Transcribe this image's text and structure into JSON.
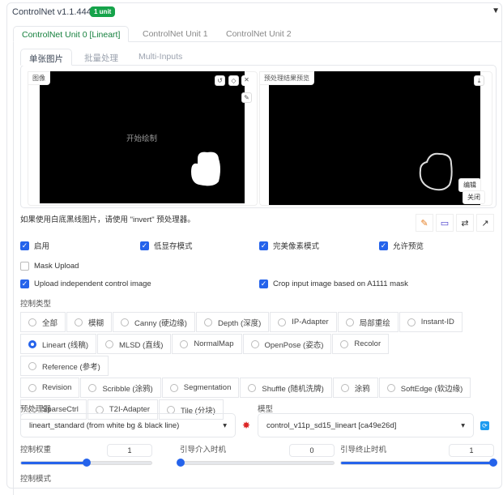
{
  "header": {
    "title": "ControlNet v1.1.444",
    "badge": "1 unit",
    "collapse_icon": "▼"
  },
  "unit_tabs": [
    "ControlNet Unit 0 [Lineart]",
    "ControlNet Unit 1",
    "ControlNet Unit 2"
  ],
  "sub_tabs": [
    "单张图片",
    "批量处理",
    "Multi-Inputs"
  ],
  "image_panel": {
    "label": "图像",
    "placeholder": "开始绘制"
  },
  "preview_panel": {
    "label": "预处理结果预览",
    "edit": "编辑",
    "close": "关闭"
  },
  "hint": "如果使用白底黑线图片，请使用 \"invert\" 预处理器。",
  "checkboxes": [
    {
      "label": "启用",
      "checked": true
    },
    {
      "label": "低显存模式",
      "checked": true
    },
    {
      "label": "完美像素模式",
      "checked": true
    },
    {
      "label": "允许预览",
      "checked": true
    },
    {
      "label": "Mask Upload",
      "checked": false
    },
    {
      "label": "Upload independent control image",
      "checked": true
    },
    {
      "label": "Crop input image based on A1111 mask",
      "checked": true
    }
  ],
  "control_type": {
    "label": "控制类型",
    "options": [
      "全部",
      "模糊",
      "Canny (硬边缘)",
      "Depth (深度)",
      "IP-Adapter",
      "局部重绘",
      "Instant-ID",
      "Lineart (线稿)",
      "MLSD (直线)",
      "NormalMap",
      "OpenPose (姿态)",
      "Recolor",
      "Reference (参考)",
      "Revision",
      "Scribble (涂鸦)",
      "Segmentation",
      "Shuffle (随机洗牌)",
      "涂鸦",
      "SoftEdge (软边缘)",
      "SparseCtrl",
      "T2I-Adapter",
      "Tile (分块)"
    ],
    "selected": "Lineart (线稿)"
  },
  "preprocessor": {
    "label": "预处理器",
    "value": "lineart_standard (from white bg & black line)"
  },
  "model": {
    "label": "模型",
    "value": "control_v11p_sd15_lineart [ca49e26d]"
  },
  "sliders": [
    {
      "label": "控制权重",
      "value": "1",
      "fraction": 0.5
    },
    {
      "label": "引导介入时机",
      "value": "0",
      "fraction": 0
    },
    {
      "label": "引导终止时机",
      "value": "1",
      "fraction": 1
    }
  ],
  "control_mode_label": "控制模式",
  "colors": {
    "accent": "#2563eb",
    "badge": "#15a34a",
    "active_tab": "#15803d"
  }
}
